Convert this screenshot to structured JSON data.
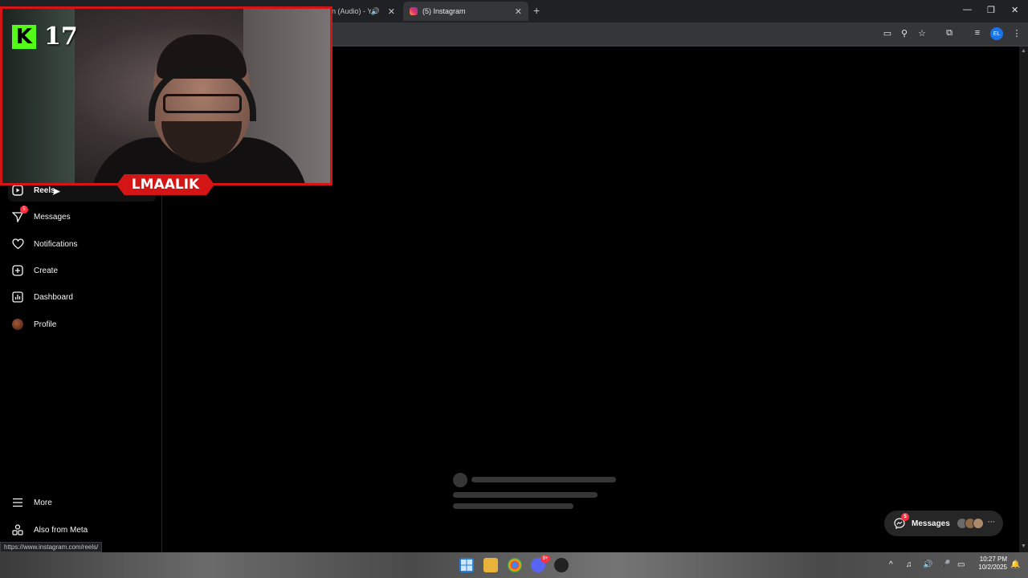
{
  "browser": {
    "tabs": [
      {
        "title": "n (Audio) - Y",
        "audio_icon": "speaker-icon"
      },
      {
        "title": "(5) Instagram",
        "active": true
      }
    ],
    "new_tab_label": "+",
    "window_controls": {
      "minimize": "—",
      "restore": "❐",
      "close": "✕"
    },
    "toolbar_icons": [
      "cast-icon",
      "zoom-icon",
      "star-icon",
      "extensions-icon",
      "media-icon",
      "profile-icon",
      "menu-icon"
    ],
    "profile_initials": "EL",
    "status_url": "https://www.instagram.com/reels/"
  },
  "sidebar": {
    "items": [
      {
        "label": "Reels",
        "icon": "reels-icon"
      },
      {
        "label": "Messages",
        "icon": "messages-icon",
        "badge": "5"
      },
      {
        "label": "Notifications",
        "icon": "heart-icon"
      },
      {
        "label": "Create",
        "icon": "plus-square-icon"
      },
      {
        "label": "Dashboard",
        "icon": "dashboard-icon"
      },
      {
        "label": "Profile",
        "icon": "profile-avatar"
      },
      {
        "label": "More",
        "icon": "hamburger-icon"
      },
      {
        "label": "Also from Meta",
        "icon": "meta-grid-icon"
      }
    ]
  },
  "messages_pill": {
    "label": "Messages",
    "badge": "5"
  },
  "overlay": {
    "platform": "K",
    "viewer_count": "17",
    "streamer_name": "LMAALIK"
  },
  "taskbar": {
    "time": "10:27 PM",
    "date": "10/2/2025",
    "discord_badge": "9+"
  },
  "colors": {
    "overlay_red": "#d31515",
    "kick_green": "#53fc18",
    "badge_red": "#ff3040"
  }
}
